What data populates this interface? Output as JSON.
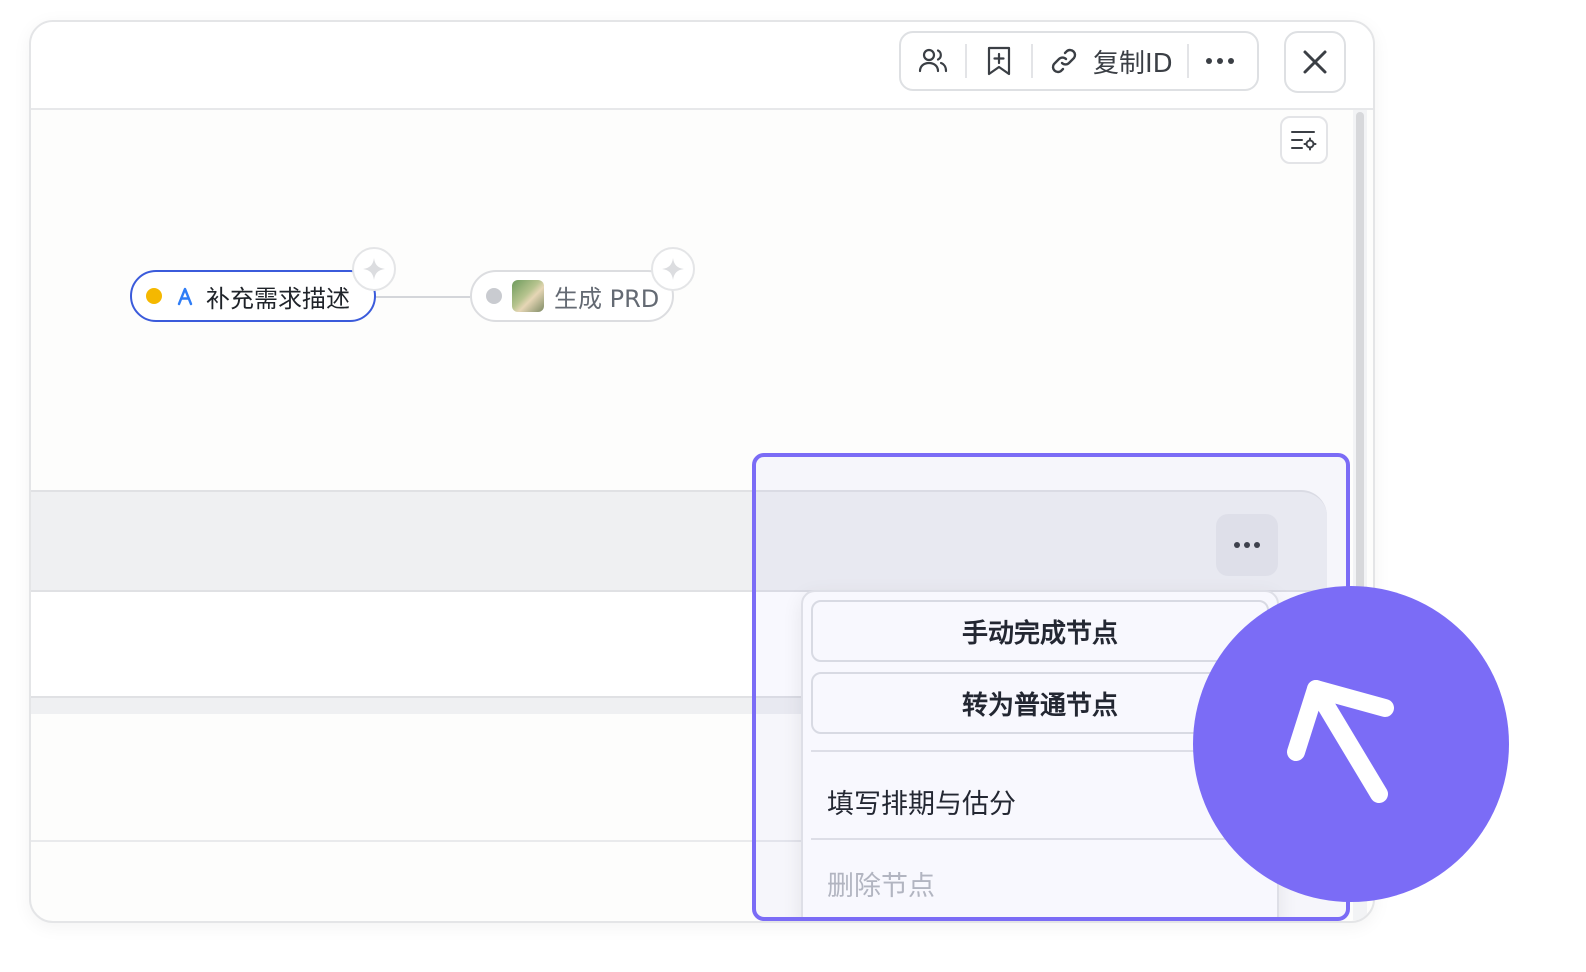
{
  "header": {
    "toolbar": {
      "members_icon": "members-icon",
      "bookmark_icon": "bookmark-add-icon",
      "link_icon": "link-icon",
      "copy_id_label": "复制ID",
      "more_icon": "more-horizontal-icon"
    },
    "close_icon": "close-icon"
  },
  "canvas": {
    "settings_icon": "list-settings-icon",
    "nodes": [
      {
        "label": "补充需求描述",
        "status_color": "#f5b800",
        "type_icon": "agent-icon",
        "selected": true
      },
      {
        "label": "生成 PRD",
        "status_color": "#c9cbd0",
        "type_icon": "avatar-thumbnail",
        "selected": false
      }
    ]
  },
  "context_menu": {
    "trigger_icon": "more-horizontal-icon",
    "buttons": [
      "手动完成节点",
      "转为普通节点"
    ],
    "items": [
      {
        "label": "填写排期与估分",
        "enabled": true
      },
      {
        "label": "删除节点",
        "enabled": false
      }
    ]
  },
  "colors": {
    "accent": "#7b6cf6",
    "selected_border": "#3b5bdb"
  }
}
